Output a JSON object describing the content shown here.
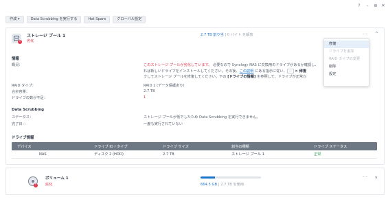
{
  "window": {
    "help_icon": "question-icon",
    "minimize_icon": "minimize-icon",
    "pin_icon": "pin-icon",
    "close_icon": "close-icon",
    "help_glyph": "?",
    "minimize_glyph": "–",
    "pin_glyph": "⊕",
    "close_glyph": "✕"
  },
  "toolbar": {
    "create_label": "作成 ▾",
    "scrub_label": "Data Scrubbing を実行する",
    "hotspare_label": "Hot Spare",
    "global_settings_label": "グローバル設定"
  },
  "pool": {
    "name": "ストレージ プール 1",
    "status": "劣化",
    "error_badge": "!",
    "usage_used": "2.7 TB 割り当",
    "usage_rest": " | 0 バイト を解放",
    "more": "···",
    "collapse": "^"
  },
  "info": {
    "section_title": "情報",
    "health_label": "概況：",
    "warning_red": "このストレージ プールが劣化しています。",
    "warning_text_1": " 必要なので Synology NAS に交換用のドライブがあるか確認し、",
    "warning_text_2": "れば新しいドライブをインストールしてください。その後、",
    "warning_link": "この説明",
    "warning_text_3": " にある指示に従い、",
    "warning_kbd": "···",
    "warning_text_4": " > 修復 ",
    "warning_text_5": "クしてストレージ プールを修復してください。下の",
    "warning_bold": " [ドライブの情報] ",
    "warning_text_6": "を参照して、ドライブが正常か",
    "raid_label": "RAID タイプ：",
    "raid_value": "RAID 1 (データ保護あり)",
    "capacity_label": "合計容量：",
    "capacity_value": "2.7 TB",
    "missing_label": "ドライブの数が不足：",
    "missing_value": "1"
  },
  "scrubbing": {
    "section_title": "Data Scrubbing",
    "status_label": "ステータス：",
    "status_value": "ストレージ プールが低下したため Data Scrubbing を実行できません。",
    "completed_label": "完了日：：",
    "completed_value": "一度も実行されていない"
  },
  "drives": {
    "section_title": "ドライブ情報",
    "columns": [
      "デバイス",
      "ドライブ ID / タイプ",
      "ドライブ サイズ",
      "割当の種類",
      "ドライブ ステータス"
    ],
    "rows": [
      {
        "device": "NAS",
        "id_type": "ディスク 2 (HDD)",
        "size": "2.7 TB",
        "allocation": "ストレージ プール 1",
        "status": "正常"
      }
    ]
  },
  "menu": {
    "items": [
      {
        "label": "修復",
        "state": "active"
      },
      {
        "label": "ドライブを追加",
        "state": "disabled"
      },
      {
        "label": "RAID タイプの変更",
        "state": "disabled"
      },
      {
        "label": "削除",
        "state": "normal"
      },
      {
        "label": "設定",
        "state": "normal"
      }
    ]
  },
  "volume": {
    "name": "ボリューム 1",
    "status": "劣化",
    "error_badge": "!",
    "usage_used": "664.5 GB",
    "usage_rest": " | 2.7 TB を使用",
    "usage_fraction": 0.24,
    "more": "···",
    "expand": "v"
  },
  "colors": {
    "accent": "#1f75cb",
    "error": "#e0374c",
    "healthy": "#2e9d57",
    "table_header": "#6e7885"
  }
}
